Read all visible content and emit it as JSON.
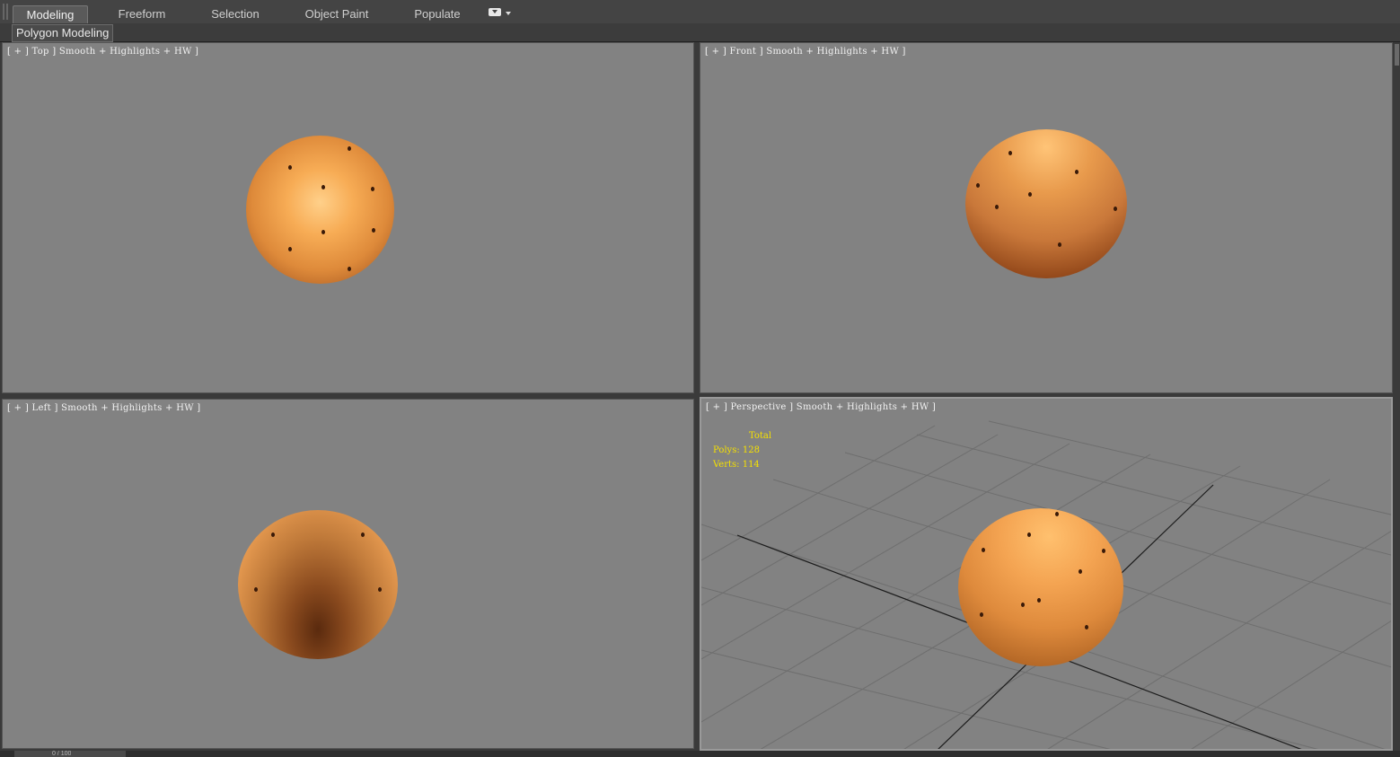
{
  "ribbon": {
    "tabs": [
      {
        "label": "Modeling",
        "active": true
      },
      {
        "label": "Freeform",
        "active": false
      },
      {
        "label": "Selection",
        "active": false
      },
      {
        "label": "Object Paint",
        "active": false
      },
      {
        "label": "Populate",
        "active": false
      }
    ],
    "extra_icon": "ribbon-options-icon"
  },
  "subbar": {
    "label": "Polygon Modeling"
  },
  "viewports": {
    "top": {
      "label": "[ + ] Top ] Smooth + Highlights + HW ]"
    },
    "front": {
      "label": "[ + ] Front ] Smooth + Highlights + HW ]"
    },
    "left": {
      "label": "[ + ] Left ] Smooth + Highlights + HW ]"
    },
    "perspective": {
      "label": "[ + ] Perspective ] Smooth + Highlights + HW ]",
      "stats": {
        "total_label": "Total",
        "polys": "Polys:  128",
        "verts": "Verts:  114"
      }
    }
  },
  "timeline": {
    "label": "0 / 100"
  },
  "colors": {
    "viewport_bg": "#828282",
    "sphere_light": "#f9b45a",
    "sphere_dark": "#6a2f10",
    "stats_text": "#f5e000"
  }
}
